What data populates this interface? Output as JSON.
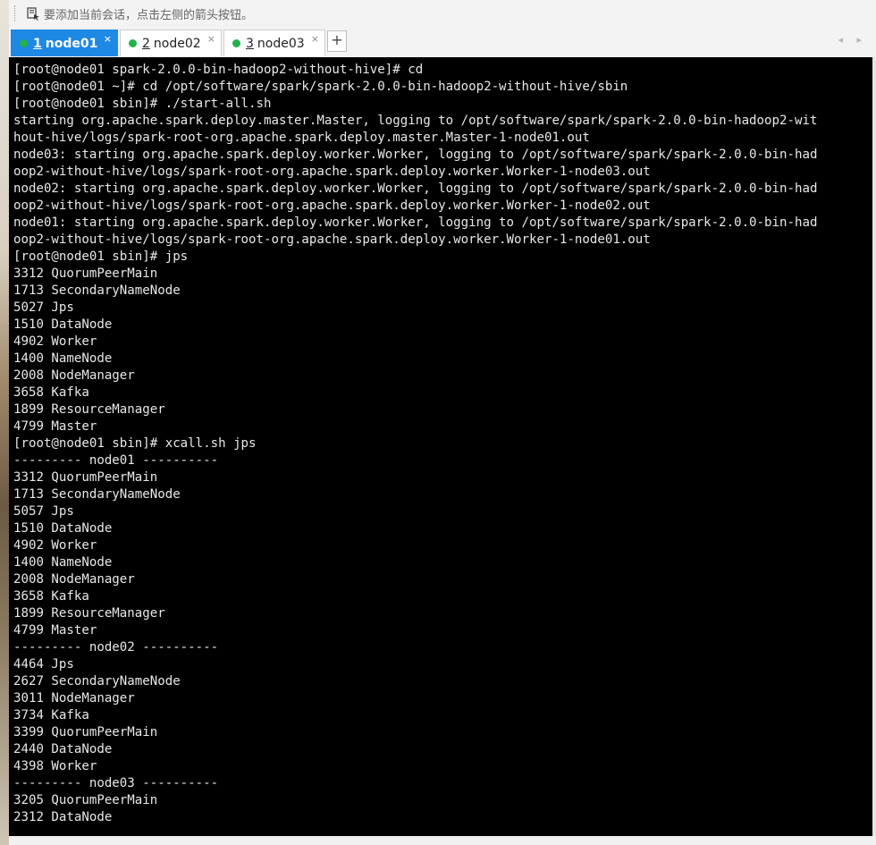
{
  "hint_bar": {
    "text": "要添加当前会话，点击左侧的箭头按钮。"
  },
  "tabs": [
    {
      "num": "1",
      "label": "node01",
      "active": true
    },
    {
      "num": "2",
      "label": "node02",
      "active": false
    },
    {
      "num": "3",
      "label": "node03",
      "active": false
    }
  ],
  "tab_close_glyph": "×",
  "tab_add_glyph": "+",
  "tab_nav_glyph": "◂ ▸",
  "colors": {
    "active_tab": "#1e88e5",
    "status_dot": "#22b14c",
    "terminal_bg": "#000000",
    "terminal_fg": "#e8e8e8"
  },
  "terminal": {
    "lines": [
      "[root@node01 spark-2.0.0-bin-hadoop2-without-hive]# cd",
      "[root@node01 ~]# cd /opt/software/spark/spark-2.0.0-bin-hadoop2-without-hive/sbin",
      "[root@node01 sbin]# ./start-all.sh",
      "starting org.apache.spark.deploy.master.Master, logging to /opt/software/spark/spark-2.0.0-bin-hadoop2-wit",
      "hout-hive/logs/spark-root-org.apache.spark.deploy.master.Master-1-node01.out",
      "node03: starting org.apache.spark.deploy.worker.Worker, logging to /opt/software/spark/spark-2.0.0-bin-had",
      "oop2-without-hive/logs/spark-root-org.apache.spark.deploy.worker.Worker-1-node03.out",
      "node02: starting org.apache.spark.deploy.worker.Worker, logging to /opt/software/spark/spark-2.0.0-bin-had",
      "oop2-without-hive/logs/spark-root-org.apache.spark.deploy.worker.Worker-1-node02.out",
      "node01: starting org.apache.spark.deploy.worker.Worker, logging to /opt/software/spark/spark-2.0.0-bin-had",
      "oop2-without-hive/logs/spark-root-org.apache.spark.deploy.worker.Worker-1-node01.out",
      "[root@node01 sbin]# jps",
      "3312 QuorumPeerMain",
      "1713 SecondaryNameNode",
      "5027 Jps",
      "1510 DataNode",
      "4902 Worker",
      "1400 NameNode",
      "2008 NodeManager",
      "3658 Kafka",
      "1899 ResourceManager",
      "4799 Master",
      "[root@node01 sbin]# xcall.sh jps",
      "--------- node01 ----------",
      "3312 QuorumPeerMain",
      "1713 SecondaryNameNode",
      "5057 Jps",
      "1510 DataNode",
      "4902 Worker",
      "1400 NameNode",
      "2008 NodeManager",
      "3658 Kafka",
      "1899 ResourceManager",
      "4799 Master",
      "--------- node02 ----------",
      "4464 Jps",
      "2627 SecondaryNameNode",
      "3011 NodeManager",
      "3734 Kafka",
      "3399 QuorumPeerMain",
      "2440 DataNode",
      "4398 Worker",
      "--------- node03 ----------",
      "3205 QuorumPeerMain",
      "2312 DataNode"
    ]
  }
}
